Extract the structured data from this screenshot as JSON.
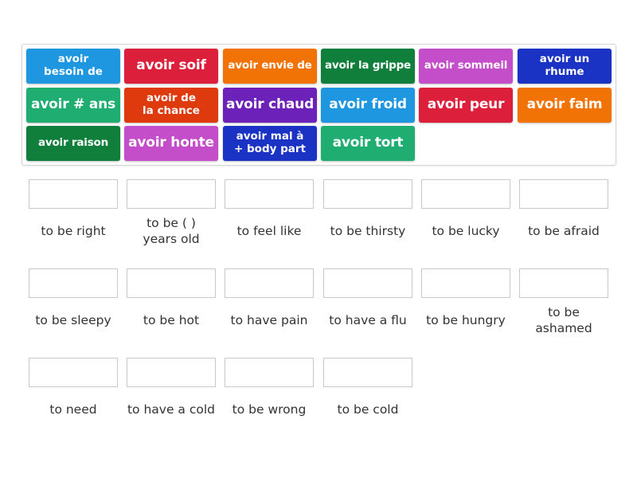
{
  "activity": {
    "type": "match-up",
    "tiles": [
      {
        "label": "avoir besoin de",
        "lines": [
          "avoir",
          "besoin de"
        ],
        "color": "#1e96e0"
      },
      {
        "label": "avoir soif",
        "lines": [
          "avoir soif"
        ],
        "color": "#dc1f3a"
      },
      {
        "label": "avoir envie de",
        "lines": [
          "avoir envie de"
        ],
        "color": "#f27305"
      },
      {
        "label": "avoir la grippe",
        "lines": [
          "avoir la grippe"
        ],
        "color": "#0f7f3b"
      },
      {
        "label": "avoir sommeil",
        "lines": [
          "avoir sommeil"
        ],
        "color": "#c44dc9"
      },
      {
        "label": "avoir un rhume",
        "lines": [
          "avoir un",
          "rhume"
        ],
        "color": "#1a33c4"
      },
      {
        "label": "avoir # ans",
        "lines": [
          "avoir # ans"
        ],
        "color": "#1fad72"
      },
      {
        "label": "avoir de la chance",
        "lines": [
          "avoir de",
          "la chance"
        ],
        "color": "#df3a0d"
      },
      {
        "label": "avoir chaud",
        "lines": [
          "avoir chaud"
        ],
        "color": "#6c22b8"
      },
      {
        "label": "avoir froid",
        "lines": [
          "avoir froid"
        ],
        "color": "#1e96e0"
      },
      {
        "label": "avoir peur",
        "lines": [
          "avoir peur"
        ],
        "color": "#dc1f3a"
      },
      {
        "label": "avoir faim",
        "lines": [
          "avoir faim"
        ],
        "color": "#f27305"
      },
      {
        "label": "avoir raison",
        "lines": [
          "avoir raison"
        ],
        "color": "#0f7f3b"
      },
      {
        "label": "avoir honte",
        "lines": [
          "avoir honte"
        ],
        "color": "#c44dc9"
      },
      {
        "label": "avoir mal à + body part",
        "lines": [
          "avoir mal à",
          "+ body part"
        ],
        "color": "#1a33c4"
      },
      {
        "label": "avoir tort",
        "lines": [
          "avoir tort"
        ],
        "color": "#1fad72"
      }
    ],
    "targets": [
      {
        "lines": [
          "to be right"
        ],
        "value": ""
      },
      {
        "lines": [
          "to be ( )",
          "years old"
        ],
        "value": ""
      },
      {
        "lines": [
          "to feel like"
        ],
        "value": ""
      },
      {
        "lines": [
          "to be thirsty"
        ],
        "value": ""
      },
      {
        "lines": [
          "to be lucky"
        ],
        "value": ""
      },
      {
        "lines": [
          "to be afraid"
        ],
        "value": ""
      },
      {
        "lines": [
          "to be sleepy"
        ],
        "value": ""
      },
      {
        "lines": [
          "to be hot"
        ],
        "value": ""
      },
      {
        "lines": [
          "to have pain"
        ],
        "value": ""
      },
      {
        "lines": [
          "to have a flu"
        ],
        "value": ""
      },
      {
        "lines": [
          "to be hungry"
        ],
        "value": ""
      },
      {
        "lines": [
          "to be",
          "ashamed"
        ],
        "value": ""
      },
      {
        "lines": [
          "to need"
        ],
        "value": ""
      },
      {
        "lines": [
          "to have a cold"
        ],
        "value": ""
      },
      {
        "lines": [
          "to be wrong"
        ],
        "value": ""
      },
      {
        "lines": [
          "to be cold"
        ],
        "value": ""
      }
    ]
  }
}
